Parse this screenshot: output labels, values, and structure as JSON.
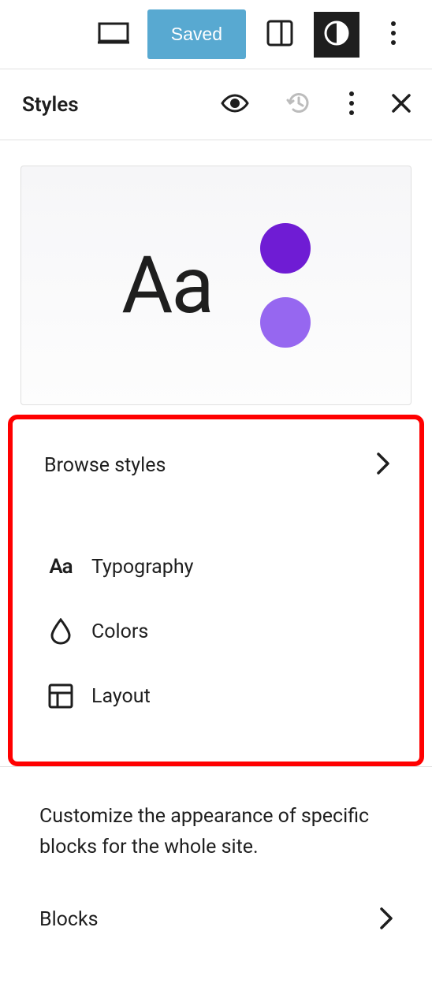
{
  "toolbar": {
    "saved_label": "Saved"
  },
  "panel": {
    "title": "Styles"
  },
  "preview": {
    "sample_text": "Aa",
    "color_primary": "#6f1cd4",
    "color_secondary": "#9667f0"
  },
  "browse": {
    "label": "Browse styles"
  },
  "options": [
    {
      "icon": "typography",
      "label": "Typography"
    },
    {
      "icon": "colors",
      "label": "Colors"
    },
    {
      "icon": "layout",
      "label": "Layout"
    }
  ],
  "blocks": {
    "description": "Customize the appearance of specific blocks for the whole site.",
    "label": "Blocks"
  }
}
